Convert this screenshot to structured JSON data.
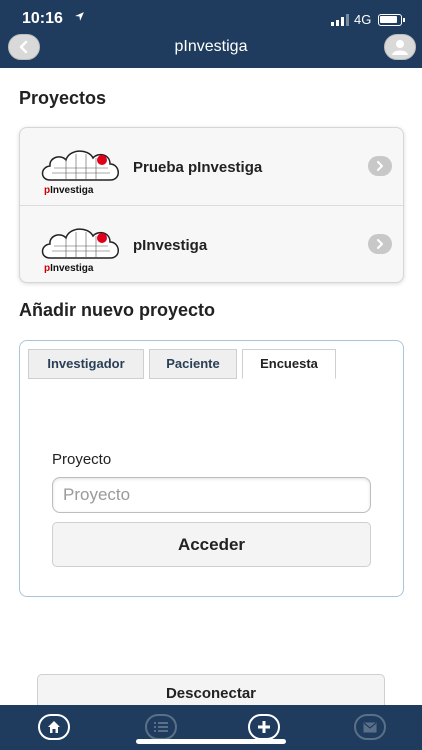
{
  "status_bar": {
    "time": "10:16",
    "network": "4G"
  },
  "header": {
    "title": "pInvestiga"
  },
  "projects": {
    "heading": "Proyectos",
    "items": [
      {
        "name": "Prueba pInvestiga",
        "logo_text": "pInvestiga"
      },
      {
        "name": "pInvestiga",
        "logo_text": "pInvestiga"
      }
    ]
  },
  "new_project": {
    "heading": "Añadir nuevo proyecto",
    "tabs": [
      "Investigador",
      "Paciente",
      "Encuesta"
    ],
    "active_tab": "Encuesta",
    "field_label": "Proyecto",
    "field_placeholder": "Proyecto",
    "field_value": "",
    "submit_label": "Acceder"
  },
  "logout_label": "Desconectar",
  "icons": {
    "back": "chevron-left-icon",
    "profile": "user-icon",
    "home": "home-icon",
    "list": "list-icon",
    "add": "plus-icon",
    "mail": "mail-icon"
  },
  "colors": {
    "header": "#1f3c5e",
    "panel_border": "#a9c5dc",
    "logo_dot": "#e0001b"
  }
}
